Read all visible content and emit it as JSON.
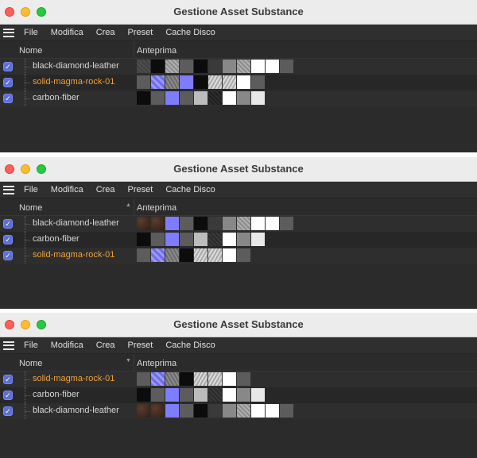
{
  "windows": [
    {
      "title": "Gestione Asset Substance",
      "menu": [
        "File",
        "Modifica",
        "Crea",
        "Preset",
        "Cache Disco"
      ],
      "columns": {
        "name": "Nome",
        "preview": "Anteprima"
      },
      "sort_indicator": "",
      "rows": [
        {
          "name": "black-diamond-leather",
          "highlighted": false,
          "thumbs": [
            "diamond",
            "black",
            "diamond2",
            "grey",
            "black",
            "darkgrey",
            "midgrey",
            "diamond2",
            "white",
            "white",
            "grey"
          ]
        },
        {
          "name": "solid-magma-rock-01",
          "highlighted": true,
          "thumbs": [
            "grey",
            "bluepat",
            "noise",
            "blue",
            "black",
            "rock",
            "rock",
            "white",
            "grey"
          ]
        },
        {
          "name": "carbon-fiber",
          "highlighted": false,
          "thumbs": [
            "black",
            "grey",
            "blue",
            "grey",
            "lightgrey",
            "carbon",
            "white",
            "midgrey",
            "offwhite"
          ]
        }
      ]
    },
    {
      "title": "Gestione Asset Substance",
      "menu": [
        "File",
        "Modifica",
        "Crea",
        "Preset",
        "Cache Disco"
      ],
      "columns": {
        "name": "Nome",
        "preview": "Anteprima"
      },
      "sort_indicator": "▲",
      "rows": [
        {
          "name": "black-diamond-leather",
          "highlighted": false,
          "thumbs": [
            "leather",
            "leather",
            "blue",
            "grey",
            "black",
            "darkgrey",
            "midgrey",
            "diamond2",
            "white",
            "white",
            "grey"
          ]
        },
        {
          "name": "carbon-fiber",
          "highlighted": false,
          "thumbs": [
            "black",
            "grey",
            "blue",
            "grey",
            "lightgrey",
            "crosshatch",
            "white",
            "midgrey",
            "offwhite"
          ]
        },
        {
          "name": "solid-magma-rock-01",
          "highlighted": true,
          "thumbs": [
            "grey",
            "bluepat",
            "noise",
            "black",
            "rock",
            "rock",
            "white",
            "grey"
          ]
        }
      ]
    },
    {
      "title": "Gestione Asset Substance",
      "menu": [
        "File",
        "Modifica",
        "Crea",
        "Preset",
        "Cache Disco"
      ],
      "columns": {
        "name": "Nome",
        "preview": "Anteprima"
      },
      "sort_indicator": "▼",
      "rows": [
        {
          "name": "solid-magma-rock-01",
          "highlighted": true,
          "thumbs": [
            "grey",
            "bluepat",
            "noise",
            "black",
            "rock",
            "rock",
            "white",
            "grey"
          ]
        },
        {
          "name": "carbon-fiber",
          "highlighted": false,
          "thumbs": [
            "black",
            "grey",
            "blue",
            "grey",
            "lightgrey",
            "crosshatch",
            "white",
            "midgrey",
            "offwhite"
          ]
        },
        {
          "name": "black-diamond-leather",
          "highlighted": false,
          "thumbs": [
            "leather",
            "leather",
            "blue",
            "grey",
            "black",
            "darkgrey",
            "midgrey",
            "diamond2",
            "white",
            "white",
            "grey"
          ]
        }
      ]
    }
  ],
  "colors": {
    "highlight": "#f0a03a",
    "checkbox": "#5d6fd6"
  }
}
